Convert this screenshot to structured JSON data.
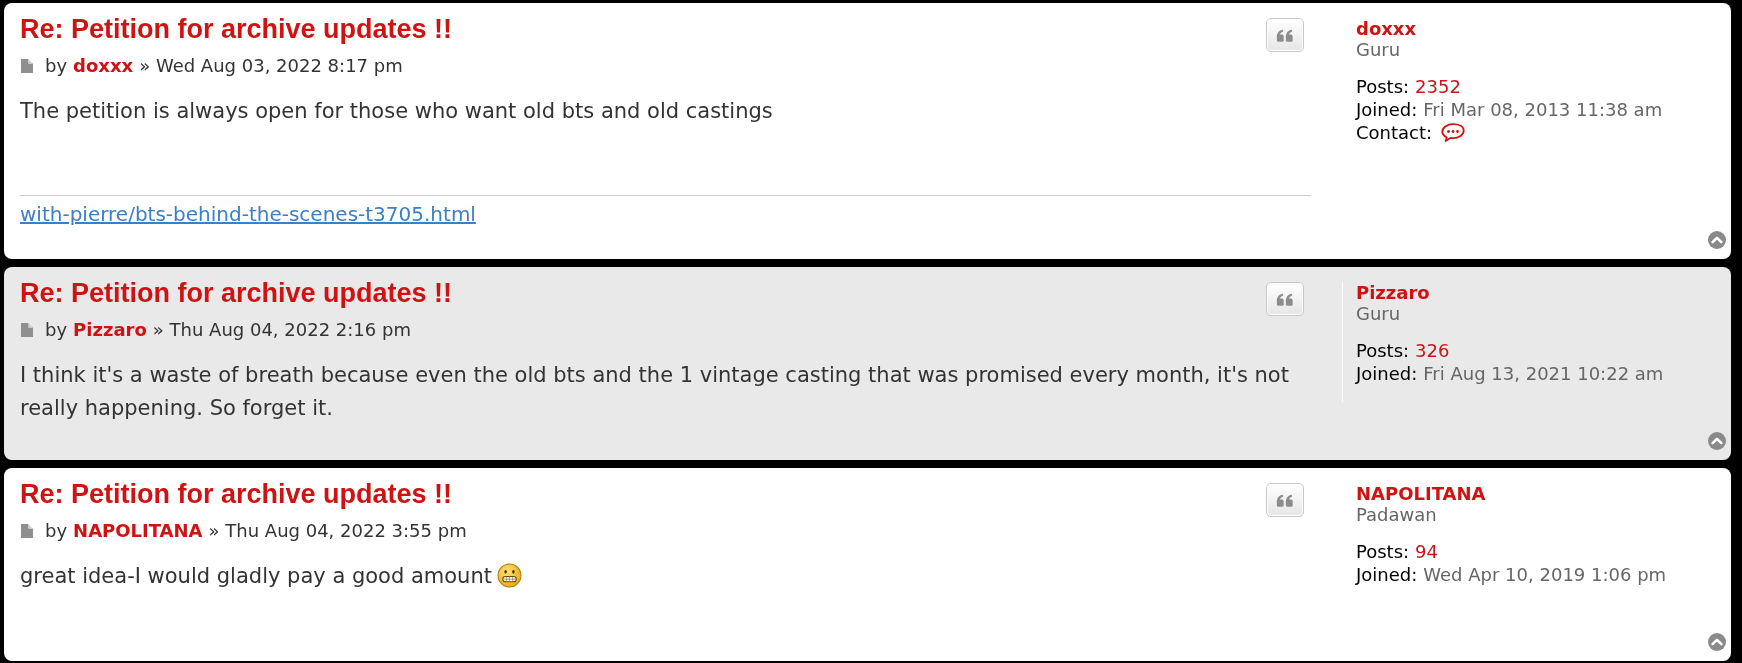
{
  "posts": [
    {
      "title": "Re: Petition for archive updates !!",
      "byline": "by",
      "author": "doxxx",
      "date": "» Wed Aug 03, 2022 8:17 pm",
      "body": "The petition is always open for those who want old bts and old castings",
      "smiley": false,
      "signature": "with-pierre/bts-behind-the-scenes-t3705.html",
      "profile": {
        "username": "doxxx",
        "rank": "Guru",
        "fields": [
          {
            "kind": "count",
            "label": "Posts:",
            "value": "2352"
          },
          {
            "kind": "date",
            "label": "Joined:",
            "value": "Fri Mar 08, 2013 11:38 am"
          },
          {
            "kind": "contact",
            "label": "Contact:"
          }
        ]
      }
    },
    {
      "title": "Re: Petition for archive updates !!",
      "byline": "by",
      "author": "Pizzaro",
      "date": "» Thu Aug 04, 2022 2:16 pm",
      "body": "I think it's a waste of breath because even the old bts and the 1 vintage casting that was promised every month, it's not really happening. So forget it.",
      "smiley": false,
      "profile": {
        "username": "Pizzaro",
        "rank": "Guru",
        "fields": [
          {
            "kind": "count",
            "label": "Posts:",
            "value": "326"
          },
          {
            "kind": "date",
            "label": "Joined:",
            "value": "Fri Aug 13, 2021 10:22 am"
          }
        ]
      }
    },
    {
      "title": "Re: Petition for archive updates !!",
      "byline": "by",
      "author": "NAPOLITANA",
      "date": "» Thu Aug 04, 2022 3:55 pm",
      "body": "great idea-I would gladly pay a good amount",
      "smiley": true,
      "profile": {
        "username": "NAPOLITANA",
        "rank": "Padawan",
        "fields": [
          {
            "kind": "count",
            "label": "Posts:",
            "value": "94"
          },
          {
            "kind": "date",
            "label": "Joined:",
            "value": "Wed Apr 10, 2019 1:06 pm"
          }
        ]
      }
    }
  ]
}
